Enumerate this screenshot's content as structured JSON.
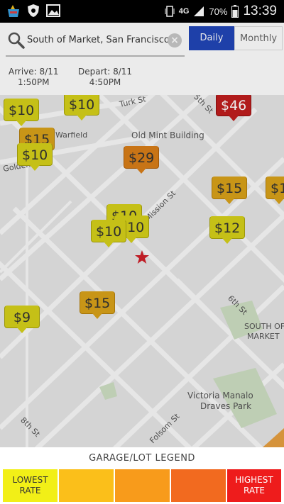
{
  "status_bar": {
    "network": "4G",
    "battery": "70%",
    "time": "13:39",
    "icons": [
      "app-bag-icon",
      "shield-icon",
      "image-icon",
      "vibrate-icon",
      "signal-icon",
      "battery-icon"
    ]
  },
  "search": {
    "value": "South of Market, San Francisco,",
    "tabs": [
      "Daily",
      "Monthly"
    ],
    "active_tab": "Daily"
  },
  "dates": {
    "arrive_label": "Arrive: 8/11",
    "arrive_time": "1:50PM",
    "depart_label": "Depart: 8/11",
    "depart_time": "4:50PM"
  },
  "map": {
    "street_labels": [
      "Turk St",
      "5th St",
      "Warfield",
      "Old Mint Building",
      "Golden Ga",
      "Mission St",
      "6th St",
      "SOUTH OF",
      "MARKET",
      "Victoria Manalo",
      "Draves Park",
      "8th St",
      "Folsom St"
    ],
    "price_pins": [
      {
        "price": "$10",
        "tier": "low"
      },
      {
        "price": "$10",
        "tier": "low"
      },
      {
        "price": "$46",
        "tier": "high"
      },
      {
        "price": "$15",
        "tier": "mid"
      },
      {
        "price": "$10",
        "tier": "low"
      },
      {
        "price": "$29",
        "tier": "orange"
      },
      {
        "price": "$15",
        "tier": "mid"
      },
      {
        "price": "$1",
        "tier": "mid"
      },
      {
        "price": "$10",
        "tier": "low"
      },
      {
        "price": "$10",
        "tier": "low"
      },
      {
        "price": "$10",
        "tier": "low"
      },
      {
        "price": "$12",
        "tier": "low"
      },
      {
        "price": "$15",
        "tier": "mid"
      },
      {
        "price": "$9",
        "tier": "low"
      }
    ],
    "marker": "star-icon"
  },
  "legend": {
    "title": "GARAGE/LOT LEGEND",
    "lowest": "LOWEST RATE",
    "highest": "HIGHEST RATE",
    "colors": [
      "#f2ef17",
      "#fbbf1a",
      "#f89b1b",
      "#f26a1f",
      "#ee1c1c"
    ]
  }
}
